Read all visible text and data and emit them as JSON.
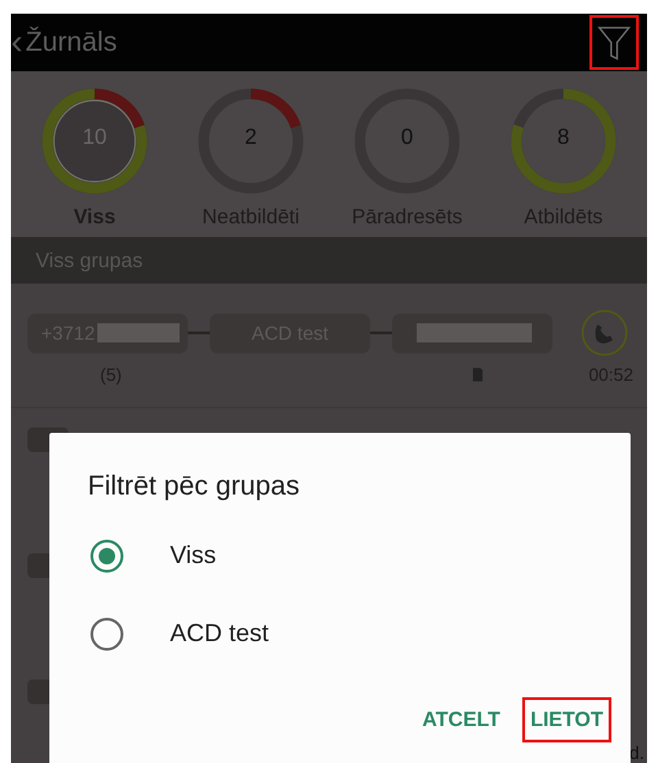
{
  "header": {
    "back": "‹",
    "title": "Žurnāls",
    "filter_highlighted": true
  },
  "stats": [
    {
      "value": "10",
      "label": "Viss",
      "selected": true,
      "arcs": [
        {
          "color": "#5c1414",
          "level": 0.2
        },
        {
          "color": "#4f5a16",
          "level": 0.8
        }
      ]
    },
    {
      "value": "2",
      "label": "Neatbildēti",
      "selected": false,
      "arcs": [
        {
          "color": "#5c1414",
          "level": 0.2
        }
      ]
    },
    {
      "value": "0",
      "label": "Pāradresēts",
      "selected": false
    },
    {
      "value": "8",
      "label": "Atbildēts",
      "selected": false,
      "arcs": [
        {
          "color": "#4f5a16",
          "level": 0.8
        }
      ]
    }
  ],
  "section": {
    "title": "Viss grupas"
  },
  "call": {
    "caller": "+3712",
    "group": "ACD test",
    "count": "(5)",
    "duration": "00:52"
  },
  "dialog": {
    "title": "Filtrēt pēc grupas",
    "options": [
      {
        "label": "Viss",
        "selected": true
      },
      {
        "label": "ACD test",
        "selected": false
      }
    ],
    "buttons": [
      {
        "label": "ATCELT",
        "highlighted": false
      },
      {
        "label": "LIETOT",
        "highlighted": true
      }
    ]
  },
  "footer_fragment": "d."
}
